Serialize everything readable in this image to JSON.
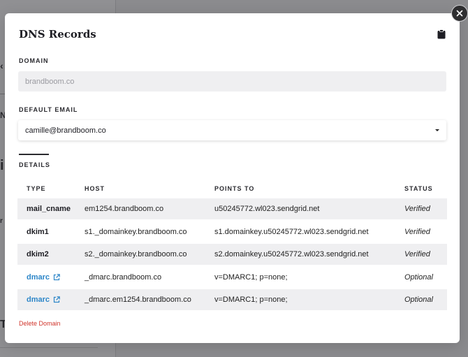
{
  "modal": {
    "title": "DNS Records",
    "domain": {
      "label": "DOMAIN",
      "value": "brandboom.co"
    },
    "default_email": {
      "label": "DEFAULT EMAIL",
      "value": "camille@brandboom.co"
    },
    "tab": "DETAILS",
    "delete_label": "Delete Domain"
  },
  "table": {
    "headers": {
      "type": "TYPE",
      "host": "HOST",
      "points_to": "POINTS TO",
      "status": "STATUS"
    },
    "rows": [
      {
        "type": "mail_cname",
        "host": "em1254.brandboom.co",
        "points_to": "u50245772.wl023.sendgrid.net",
        "status": "Verified"
      },
      {
        "type": "dkim1",
        "host": "s1._domainkey.brandboom.co",
        "points_to": "s1.domainkey.u50245772.wl023.sendgrid.net",
        "status": "Verified"
      },
      {
        "type": "dkim2",
        "host": "s2._domainkey.brandboom.co",
        "points_to": "s2.domainkey.u50245772.wl023.sendgrid.net",
        "status": "Verified"
      },
      {
        "type": "dmarc",
        "host": "_dmarc.brandboom.co",
        "points_to": "v=DMARC1; p=none;",
        "status": "Optional"
      },
      {
        "type": "dmarc",
        "host": "_dmarc.em1254.brandboom.co",
        "points_to": "v=DMARC1; p=none;",
        "status": "Optional"
      }
    ]
  },
  "background": {
    "glyphs": [
      "‹",
      "N",
      "i",
      "r",
      "T"
    ]
  },
  "colors": {
    "link": "#2d86c8",
    "danger": "#d0352c",
    "overlay": "#8b8b8e"
  },
  "icons": {
    "close": "close-icon",
    "clipboard": "clipboard-icon",
    "external_link": "external-link-icon",
    "dropdown": "chevron-down-icon"
  }
}
